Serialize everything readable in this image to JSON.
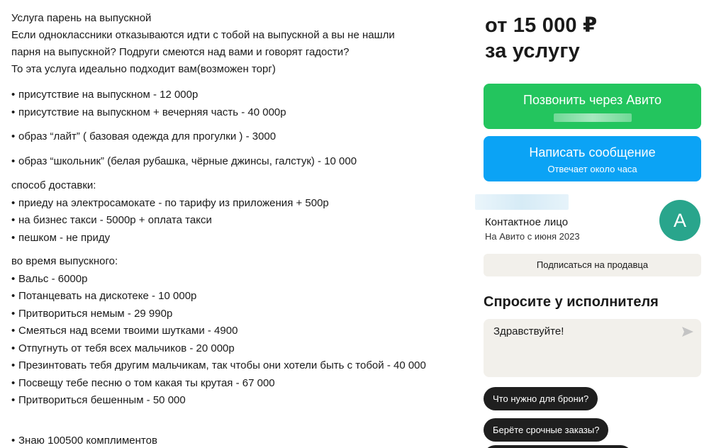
{
  "description": {
    "intro": [
      "Услуга парень на выпускной",
      "Если одноклассники отказываются идти с тобой на выпускной а вы не нашли",
      "парня на выпускной? Подруги смеются над вами и говорят гадости?",
      "То эта услуга идеально подходит вам(возможен торг)"
    ],
    "items": [
      "присутствие на выпускном - 12 000р",
      "присутствие на выпускном + вечерняя часть - 40 000р",
      "образ “лайт” ( базовая одежда для прогулки ) - 3000",
      "образ “школьник” (белая рубашка, чёрные джинсы, галстук) - 10 000"
    ],
    "delivery_heading": "способ доставки:",
    "delivery": [
      "приеду на электросамокате - по тарифу из приложения + 500р",
      "на бизнес такси - 5000р + оплата такси",
      "пешком - не приду"
    ],
    "during_heading": "во время выпускного:",
    "during": [
      "Вальс - 6000р",
      "Потанцевать на дискотеке - 10 000р",
      "Притвориться немым - 29 990р",
      "Смеяться над всеми твоими шутками - 4900",
      "Отпугнуть от тебя всех мальчиков - 20 000р",
      "Презинтовать тебя другим мальчикам, так чтобы они хотели быть с тобой - 40 000",
      "Посвещу тебе песню о том какая ты крутая - 67 000",
      "Притвориться бешенным - 50 000"
    ],
    "last": "Знаю 100500 комплиментов",
    "bullet": "•"
  },
  "sidebar": {
    "price_line1": "от 15 000 ₽",
    "price_line2": "за услугу",
    "call_label": "Позвонить через Авито",
    "message_label": "Написать сообщение",
    "message_sub": "Отвечает около часа",
    "seller_type": "Контактное лицо",
    "seller_since": "На Авито с июня 2023",
    "avatar_letter": "А",
    "subscribe_label": "Подписаться на продавца",
    "ask_title": "Спросите у исполнителя",
    "ask_value": "Здравствуйте!",
    "chips": [
      "Что нужно для брони?",
      "Берёте срочные заказы?"
    ]
  },
  "colors": {
    "call": "#23c55e",
    "message": "#0ba3f5",
    "avatar": "#29a58c",
    "chip": "#1f1f1f",
    "panel": "#f2f0eb"
  },
  "icons": {
    "send": "send-arrow-icon"
  }
}
